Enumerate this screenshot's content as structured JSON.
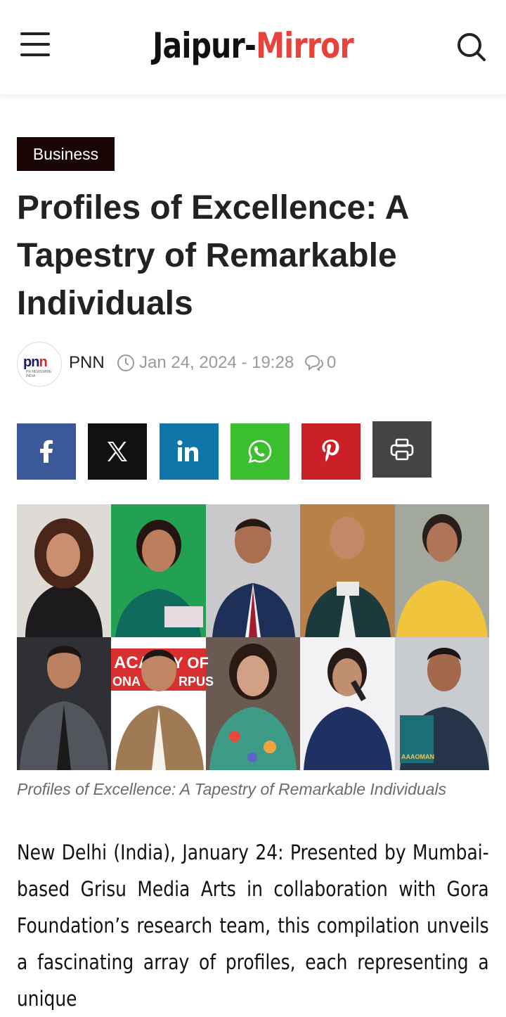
{
  "header": {
    "logo_part1": "Jaipur-",
    "logo_part2": "Mirror",
    "menu_icon": "hamburger-menu-icon",
    "search_icon": "search-icon",
    "accent_color": "#e5433b"
  },
  "article": {
    "category": "Business",
    "title": "Profiles of Excellence: A Tapestry of Remarkable Individuals",
    "author": "PNN",
    "author_logo": {
      "text_main": "pn",
      "text_accent": "n",
      "subtext": "PR NEWSWIRE INDIA"
    },
    "date": "Jan 24, 2024 - 19:28",
    "comment_count": "0",
    "image_caption": "Profiles of Excellence: A Tapestry of Remarkable Individuals",
    "body": "New Delhi (India), January 24: Presented by Mumbai-based Grisu Media Arts in collaboration with Gora Foundation’s research team, this compilation unveils a fascinating array of profiles, each representing a unique"
  },
  "share_buttons": [
    {
      "network": "facebook",
      "icon": "facebook-icon",
      "color": "#3b5998"
    },
    {
      "network": "x",
      "icon": "x-icon",
      "color": "#111111"
    },
    {
      "network": "linkedin",
      "icon": "linkedin-icon",
      "color": "#0e76a8"
    },
    {
      "network": "whatsapp",
      "icon": "whatsapp-icon",
      "color": "#3cbf2f"
    },
    {
      "network": "pinterest",
      "icon": "pinterest-icon",
      "color": "#cb2027"
    },
    {
      "network": "print",
      "icon": "print-icon",
      "color": "#444444"
    }
  ],
  "hero_image": {
    "description_visible_text": [
      "ACA",
      "Y OF",
      "ONA",
      "RPUS",
      "AAAOMAN"
    ]
  }
}
